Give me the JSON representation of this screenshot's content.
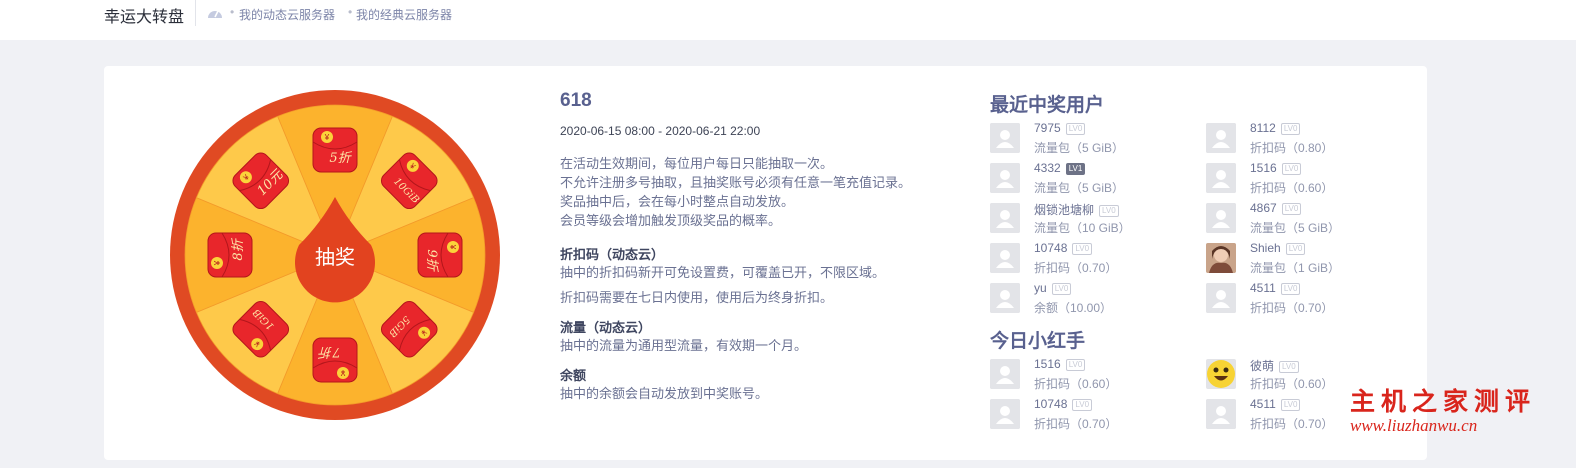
{
  "topbar": {
    "title": "幸运大转盘",
    "breadcrumbs": [
      "我的动态云服务器",
      "我的经典云服务器"
    ],
    "icon": "dashboard-icon"
  },
  "wheel": {
    "center_label": "抽奖",
    "prizes": [
      "5折",
      "10GiB",
      "9折",
      "5GiB",
      "7折",
      "1GiB",
      "8折",
      "10元"
    ],
    "colors": {
      "rim": "#e04a23",
      "slice_dark": "#fcb32d",
      "slice_light": "#fec94a",
      "envelope": "#e8262b"
    }
  },
  "event": {
    "title": "618",
    "date_range": "2020-06-15 08:00 - 2020-06-21 22:00",
    "rules": [
      "在活动生效期间，每位用户每日只能抽取一次。",
      "不允许注册多号抽取，且抽奖账号必须有任意一笔充值记录。",
      "奖品抽中后，会在每小时整点自动发放。",
      "会员等级会增加触发顶级奖品的概率。"
    ],
    "sections": [
      {
        "heading": "折扣码（动态云）",
        "desc": "抽中的折扣码新开可免设置费，可覆盖已开，不限区域。",
        "desc2": "折扣码需要在七日内使用，使用后为终身折扣。"
      },
      {
        "heading": "流量（动态云）",
        "desc": "抽中的流量为通用型流量，有效期一个月。",
        "desc2": ""
      },
      {
        "heading": "余额",
        "desc": "抽中的余额会自动发放到中奖账号。",
        "desc2": ""
      }
    ]
  },
  "recent": {
    "title": "最近中奖用户",
    "entries": [
      {
        "name": "7975",
        "lv": "LV0",
        "prize": "流量包（5 GiB）"
      },
      {
        "name": "8112",
        "lv": "LV0",
        "prize": "折扣码（0.80）"
      },
      {
        "name": "4332",
        "lv": "LV1",
        "prize": "流量包（5 GiB）"
      },
      {
        "name": "1516",
        "lv": "LV0",
        "prize": "折扣码（0.60）"
      },
      {
        "name": "烟锁池塘柳",
        "lv": "LV0",
        "prize": "流量包（10 GiB）"
      },
      {
        "name": "4867",
        "lv": "LV0",
        "prize": "流量包（5 GiB）"
      },
      {
        "name": "10748",
        "lv": "LV0",
        "prize": "折扣码（0.70）"
      },
      {
        "name": "Shieh",
        "lv": "LV0",
        "prize": "流量包（1 GiB）"
      },
      {
        "name": "yu",
        "lv": "LV0",
        "prize": "余额（10.00）"
      },
      {
        "name": "4511",
        "lv": "LV0",
        "prize": "折扣码（0.70）"
      }
    ]
  },
  "today": {
    "title": "今日小红手",
    "entries": [
      {
        "name": "1516",
        "lv": "LV0",
        "prize": "折扣码（0.60）"
      },
      {
        "name": "彼萌",
        "lv": "LV0",
        "prize": "折扣码（0.60）"
      },
      {
        "name": "10748",
        "lv": "LV0",
        "prize": "折扣码（0.70）"
      },
      {
        "name": "4511",
        "lv": "LV0",
        "prize": "折扣码（0.70）"
      }
    ]
  },
  "watermark": {
    "cn": "主机之家测评",
    "url": "www.liuzhanwu.cn"
  }
}
